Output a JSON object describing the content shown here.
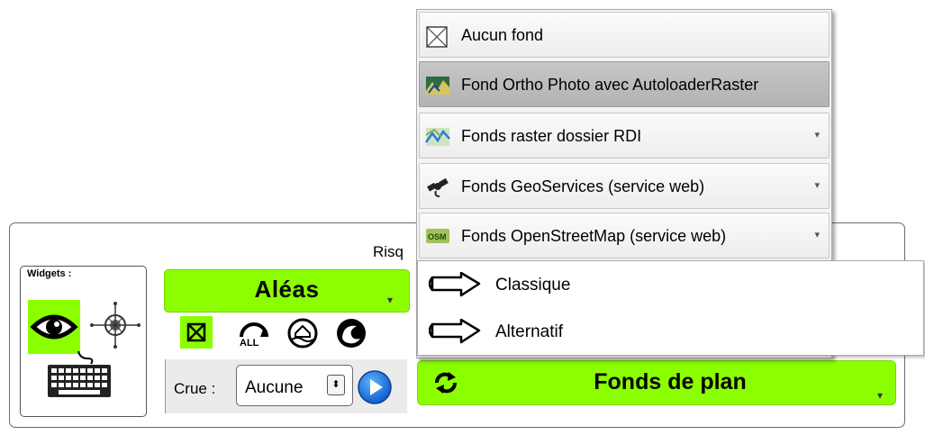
{
  "panel": {
    "title": "Risq"
  },
  "widgets": {
    "label": "Widgets :",
    "icons": [
      "eye-icon",
      "compass-icon",
      "keyboard-icon"
    ]
  },
  "aleas": {
    "label": "Aléas"
  },
  "toolbar_icons": [
    "no-layer-icon",
    "all-flood-icon",
    "house-flood-icon",
    "swirl-icon"
  ],
  "crue": {
    "label": "Crue :",
    "value": "Aucune"
  },
  "fonds_plan": {
    "label": "Fonds de plan"
  },
  "menu": {
    "items": [
      {
        "label": "Aucun fond",
        "icon": "empty-box-icon",
        "has_submenu": false
      },
      {
        "label": "Fond Ortho Photo avec AutoloaderRaster",
        "icon": "ortho-map-icon",
        "has_submenu": false
      },
      {
        "label": "Fonds raster dossier RDI",
        "icon": "raster-map-icon",
        "has_submenu": true
      },
      {
        "label": "Fonds GeoServices (service web)",
        "icon": "satellite-icon",
        "has_submenu": true
      },
      {
        "label": "Fonds OpenStreetMap (service web)",
        "icon": "osm-icon",
        "has_submenu": true
      }
    ]
  },
  "submenu": {
    "items": [
      {
        "label": "Classique",
        "icon": "arrow-outline-icon"
      },
      {
        "label": "Alternatif",
        "icon": "arrow-outline-icon"
      }
    ]
  },
  "colors": {
    "accent_green": "#8bff00",
    "highlight": "#b9b9b9"
  }
}
